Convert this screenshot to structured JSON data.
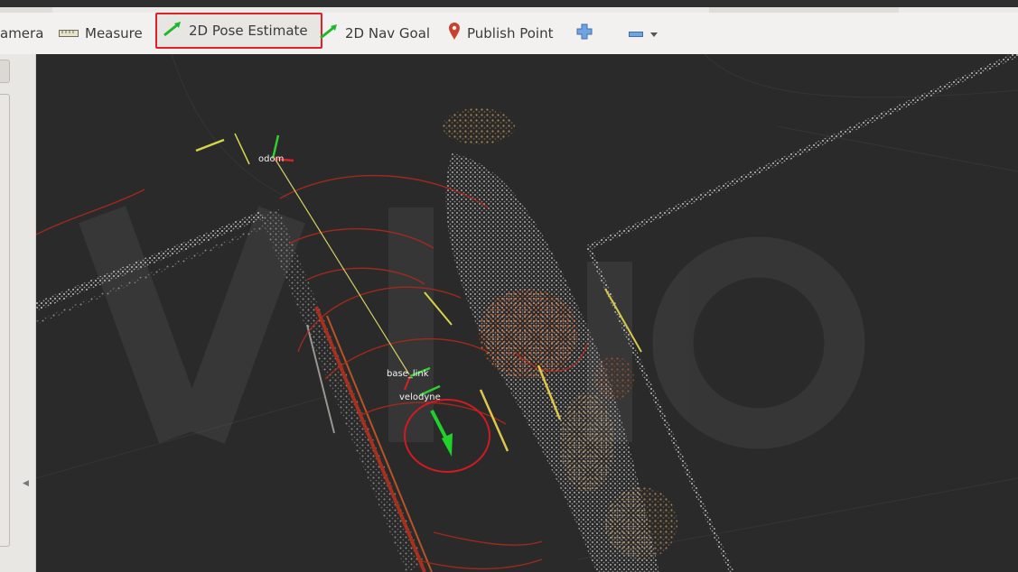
{
  "toolbar": {
    "camera_label": "amera",
    "measure_label": "Measure",
    "pose_estimate_label": "2D Pose Estimate",
    "nav_goal_label": "2D Nav Goal",
    "publish_point_label": "Publish Point"
  },
  "viewport": {
    "frames": {
      "odom_label": "odom",
      "base_link_label": "base_link",
      "velodyne_label": "velodyne"
    }
  },
  "colors": {
    "selection_outline": "#e0202a",
    "pose_arrow": "#1fd12a",
    "viewport_bg": "#2b2b2b"
  }
}
